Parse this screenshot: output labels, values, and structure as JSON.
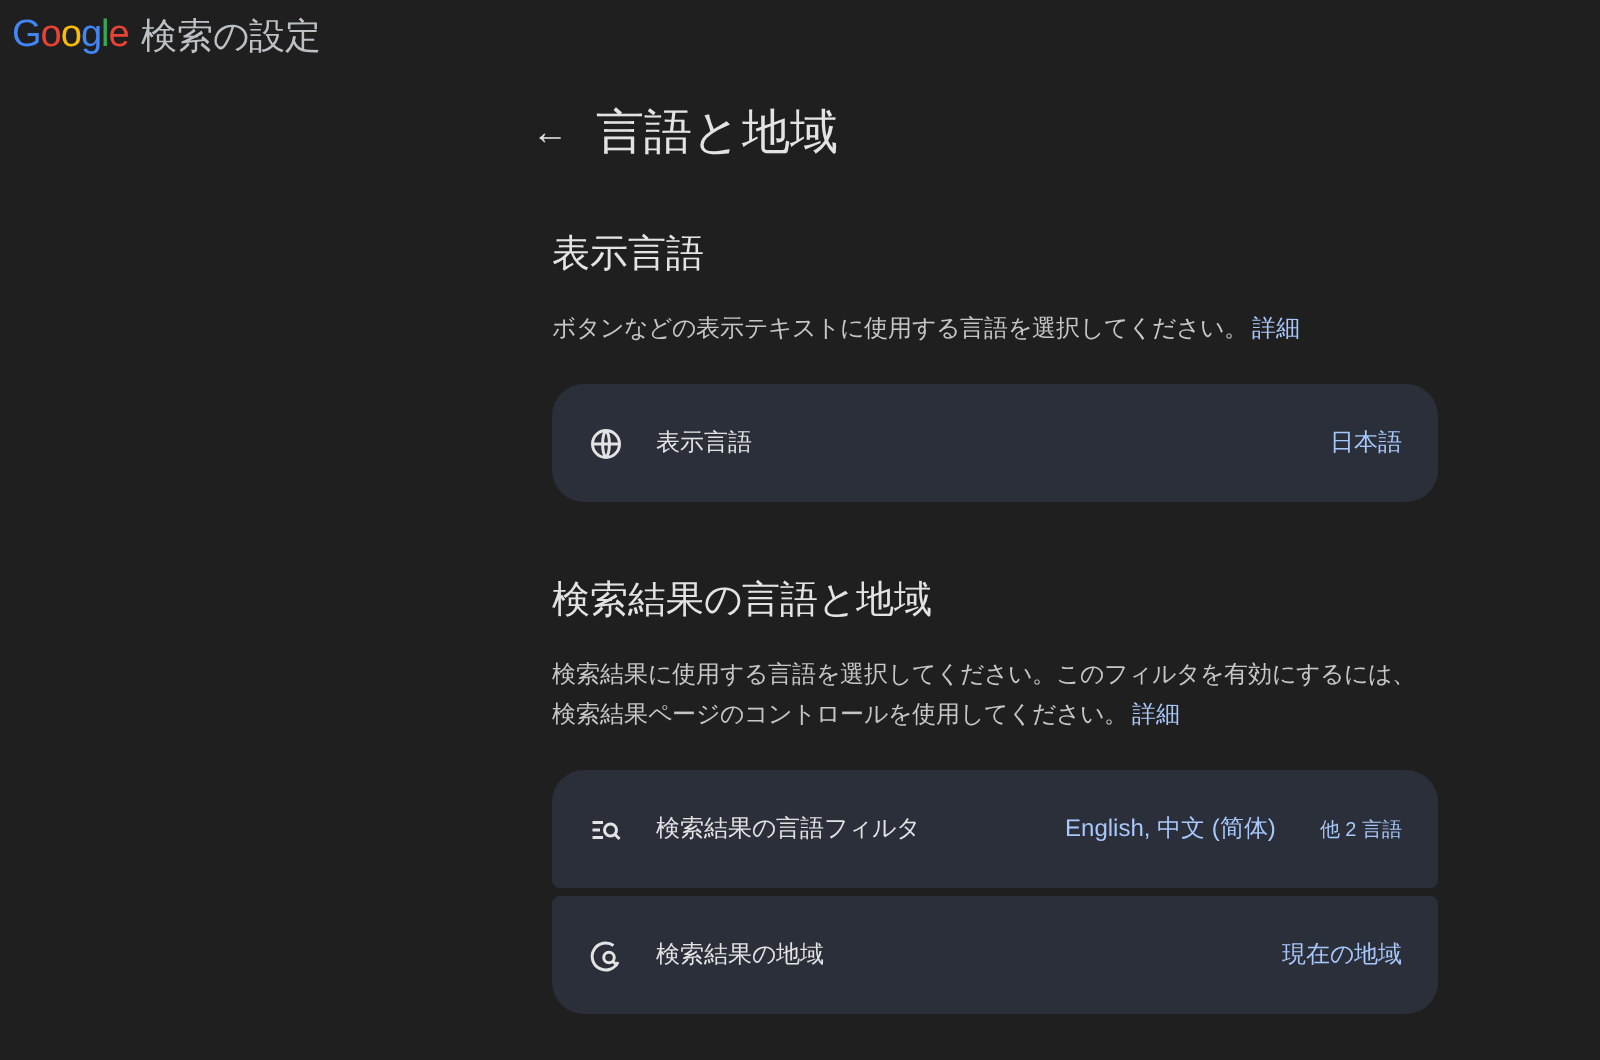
{
  "header": {
    "logo": "Google",
    "title": "検索の設定"
  },
  "page": {
    "back": "←",
    "title": "言語と地域"
  },
  "sections": [
    {
      "heading": "表示言語",
      "description": "ボタンなどの表示テキストに使用する言語を選択してください。",
      "link": "詳細",
      "rows": [
        {
          "kind": "globe",
          "label": "表示言語",
          "value": "日本語"
        }
      ]
    },
    {
      "heading": "検索結果の言語と地域",
      "description": "検索結果に使用する言語を選択してください。このフィルタを有効にするには、検索結果ページのコントロールを使用してください。",
      "link": "詳細",
      "rows": [
        {
          "kind": "filter",
          "label": "検索結果の言語フィルタ",
          "value": "English, 中文 (简体)",
          "extra": "他 2 言語"
        },
        {
          "kind": "region",
          "label": "検索結果の地域",
          "value": "現在の地域"
        }
      ]
    }
  ]
}
